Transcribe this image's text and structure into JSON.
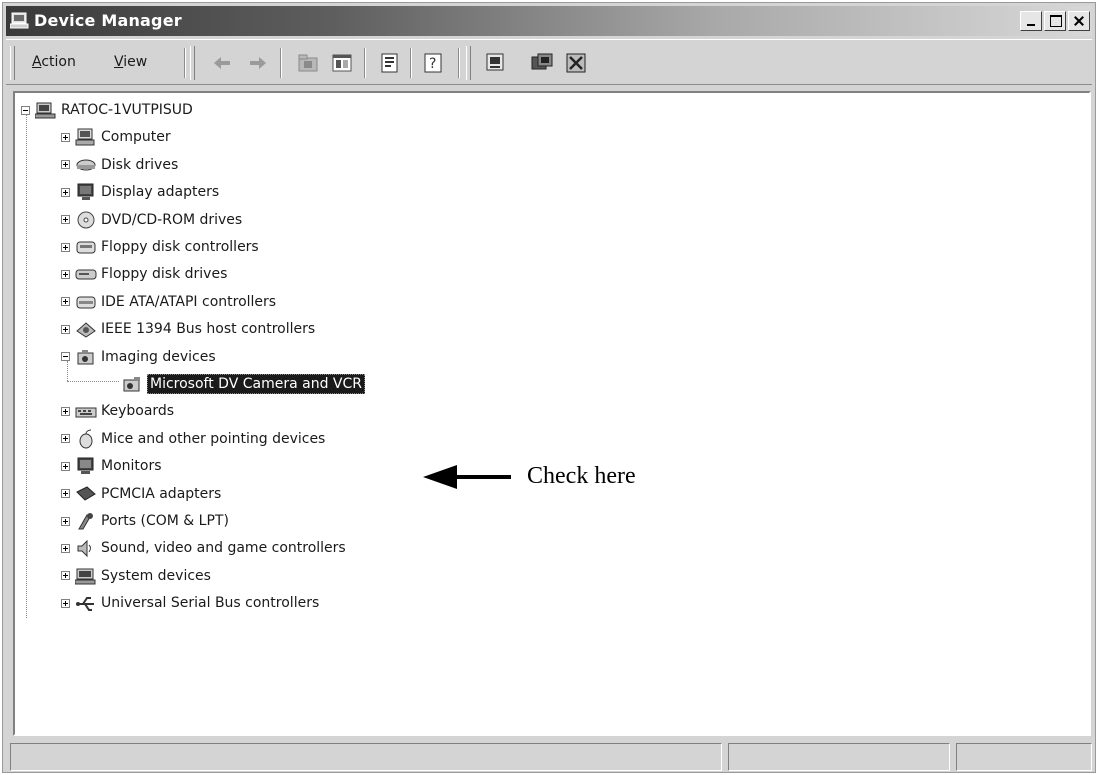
{
  "window": {
    "title": "Device Manager"
  },
  "menu": {
    "action": {
      "mnemonic": "A",
      "rest": "ction"
    },
    "view": {
      "mnemonic": "V",
      "rest": "iew"
    }
  },
  "toolbar_icons": [
    "back-arrow-icon",
    "forward-arrow-icon",
    "up-folder-icon",
    "show-hide-tree-icon",
    "properties-icon",
    "help-icon",
    "scan-hardware-icon",
    "update-driver-icon",
    "uninstall-icon"
  ],
  "tree": {
    "root": "RATOC-1VUTPISUD",
    "categories": [
      {
        "label": "Computer",
        "icon": "computer-icon"
      },
      {
        "label": "Disk drives",
        "icon": "disk-drive-icon"
      },
      {
        "label": "Display adapters",
        "icon": "display-adapter-icon"
      },
      {
        "label": "DVD/CD-ROM drives",
        "icon": "cdrom-icon"
      },
      {
        "label": "Floppy disk controllers",
        "icon": "floppy-controller-icon"
      },
      {
        "label": "Floppy disk drives",
        "icon": "floppy-drive-icon"
      },
      {
        "label": "IDE ATA/ATAPI controllers",
        "icon": "ide-controller-icon"
      },
      {
        "label": "IEEE 1394 Bus host controllers",
        "icon": "ieee1394-icon"
      },
      {
        "label": "Imaging devices",
        "icon": "camera-icon",
        "expanded": true
      },
      {
        "label": "Keyboards",
        "icon": "keyboard-icon"
      },
      {
        "label": "Mice and other pointing devices",
        "icon": "mouse-icon"
      },
      {
        "label": "Monitors",
        "icon": "monitor-icon"
      },
      {
        "label": "PCMCIA adapters",
        "icon": "pcmcia-icon"
      },
      {
        "label": "Ports (COM & LPT)",
        "icon": "port-icon"
      },
      {
        "label": "Sound, video and game controllers",
        "icon": "sound-icon"
      },
      {
        "label": "System devices",
        "icon": "system-device-icon"
      },
      {
        "label": "Universal Serial Bus controllers",
        "icon": "usb-icon"
      }
    ],
    "imaging_child": "Microsoft DV Camera and VCR"
  },
  "annotation": {
    "text": "Check here"
  },
  "status": {
    "cell1": "",
    "cell2": "",
    "cell3": ""
  }
}
